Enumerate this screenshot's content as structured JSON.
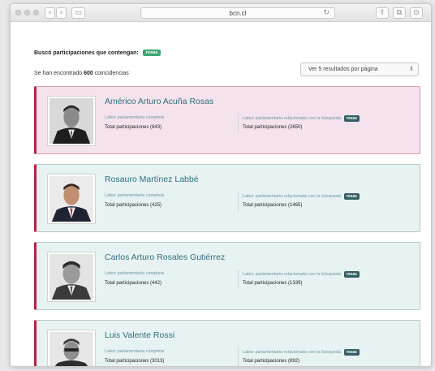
{
  "browser": {
    "url": "bcn.cl",
    "back_symbol": "‹",
    "forward_symbol": "›",
    "reload_symbol": "↻",
    "share_symbol": "⇪",
    "tabs_symbol": "⧉",
    "download_symbol": "⊙",
    "sidebar_symbol": "▭"
  },
  "search": {
    "prefix": "Buscó participaciones que contengan:",
    "term": "rosas"
  },
  "results": {
    "found_prefix": "Se han encontrado ",
    "found_count": "600",
    "found_suffix": " coincidencias",
    "per_page_label": "Ver 5 resultados por página",
    "per_page_arrows": "⇕"
  },
  "cards": [
    {
      "name": "Américo Arturo Acuña Rosas",
      "left_label": "Labor parlamentaria completa",
      "left_total": "Total participaciones (843)",
      "right_label": "Labor parlamentaria relacionada con la búsqueda",
      "right_tag": "rosas",
      "right_total": "Total participaciones (2650)"
    },
    {
      "name": "Rosauro Martínez Labbé",
      "left_label": "Labor parlamentaria completa",
      "left_total": "Total participaciones (425)",
      "right_label": "Labor parlamentaria relacionada con la búsqueda",
      "right_tag": "rosas",
      "right_total": "Total participaciones (1465)"
    },
    {
      "name": "Carlos Arturo Rosales Gutiérrez",
      "left_label": "Labor parlamentaria completa",
      "left_total": "Total participaciones (442)",
      "right_label": "Labor parlamentaria relacionada con la búsqueda",
      "right_tag": "rosas",
      "right_total": "Total participaciones (1339)"
    },
    {
      "name": "Luis Valente Rossi",
      "left_label": "Labor parlamentaria completa",
      "left_total": "Total participaciones (3013)",
      "right_label": "Labor parlamentaria relacionada con la búsqueda",
      "right_tag": "rosas",
      "right_total": "Total participaciones (892)"
    }
  ]
}
